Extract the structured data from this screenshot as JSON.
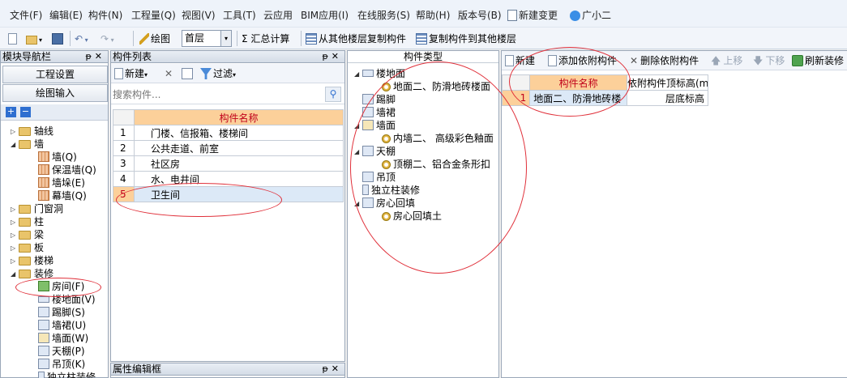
{
  "menu": [
    "文件(F)",
    "编辑(E)",
    "构件(N)",
    "工程量(Q)",
    "视图(V)",
    "工具(T)",
    "云应用",
    "BIM应用(I)",
    "在线服务(S)",
    "帮助(H)",
    "版本号(B)",
    "新建变更",
    "广小二"
  ],
  "toolbar": {
    "draw_label": "绘图",
    "floor_value": "首层",
    "sum_label": "Σ 汇总计算",
    "copy_from_label": "从其他楼层复制构件",
    "copy_to_label": "复制构件到其他楼层"
  },
  "nav": {
    "title": "模块导航栏",
    "btn_project": "工程设置",
    "btn_draw": "绘图输入",
    "tree": [
      {
        "label": "轴线"
      },
      {
        "label": "墙"
      },
      {
        "label": "墙(Q)"
      },
      {
        "label": "保温墙(Q)"
      },
      {
        "label": "墙垛(E)"
      },
      {
        "label": "幕墙(Q)"
      },
      {
        "label": "门窗洞"
      },
      {
        "label": "柱"
      },
      {
        "label": "梁"
      },
      {
        "label": "板"
      },
      {
        "label": "楼梯"
      },
      {
        "label": "装修"
      },
      {
        "label": "房间(F)"
      },
      {
        "label": "楼地面(V)"
      },
      {
        "label": "踢脚(S)"
      },
      {
        "label": "墙裙(U)"
      },
      {
        "label": "墙面(W)"
      },
      {
        "label": "天棚(P)"
      },
      {
        "label": "吊顶(K)"
      },
      {
        "label": "独立柱装修"
      }
    ]
  },
  "complist": {
    "title": "构件列表",
    "new_label": "新建",
    "filter_label": "过滤",
    "search_placeholder": "搜索构件...",
    "header": "构件名称",
    "rows": [
      {
        "idx": "1",
        "name": "门楼、信报箱、楼梯间"
      },
      {
        "idx": "2",
        "name": "公共走道、前室"
      },
      {
        "idx": "3",
        "name": "社区房"
      },
      {
        "idx": "4",
        "name": "水、电井间"
      },
      {
        "idx": "5",
        "name": "卫生间"
      }
    ]
  },
  "propbox": {
    "title": "属性编辑框"
  },
  "comptype": {
    "title": "构件类型",
    "items": [
      {
        "label": "楼地面"
      },
      {
        "label": "地面二、防滑地砖楼面"
      },
      {
        "label": "踢脚"
      },
      {
        "label": "墙裙"
      },
      {
        "label": "墙面"
      },
      {
        "label": "内墙二、 高级彩色釉面"
      },
      {
        "label": "天棚"
      },
      {
        "label": "顶棚二、铝合金条形扣"
      },
      {
        "label": "吊顶"
      },
      {
        "label": "独立柱装修"
      },
      {
        "label": "房心回填"
      },
      {
        "label": "房心回填土"
      }
    ]
  },
  "attached": {
    "new_label": "新建",
    "add_label": "添加依附构件",
    "delete_label": "删除依附构件",
    "up_label": "上移",
    "down_label": "下移",
    "refresh_label": "刷新装修",
    "col_name": "构件名称",
    "col_height": "依附构件顶标高(m",
    "rows": [
      {
        "idx": "1",
        "name": "地面二、防滑地砖楼",
        "height": "层底标高"
      }
    ]
  },
  "colors": {
    "annotation": "#e0303a",
    "header_bg": "#fcd09a",
    "header_text": "#c0001a"
  }
}
